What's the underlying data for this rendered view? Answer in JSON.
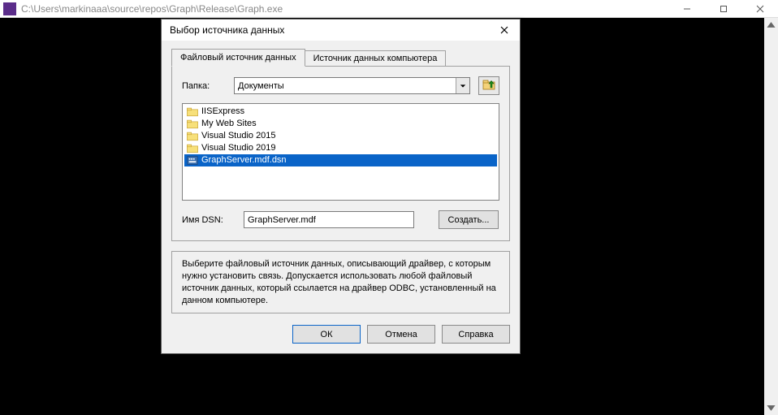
{
  "app": {
    "title": "C:\\Users\\markinaaa\\source\\repos\\Graph\\Release\\Graph.exe"
  },
  "dialog": {
    "title": "Выбор источника данных",
    "tabs": {
      "file": "Файловый источник данных",
      "machine": "Источник данных компьютера"
    },
    "folder": {
      "label": "Папка:",
      "value": "Документы"
    },
    "files": {
      "items": [
        {
          "name": "IISExpress",
          "kind": "folder",
          "selected": false
        },
        {
          "name": "My Web Sites",
          "kind": "folder",
          "selected": false
        },
        {
          "name": "Visual Studio 2015",
          "kind": "folder",
          "selected": false
        },
        {
          "name": "Visual Studio 2019",
          "kind": "folder",
          "selected": false
        },
        {
          "name": "GraphServer.mdf.dsn",
          "kind": "dsn",
          "selected": true
        }
      ]
    },
    "dsn": {
      "label": "Имя DSN:",
      "value": "GraphServer.mdf"
    },
    "create_btn": "Создать...",
    "hint": "Выберите файловый источник данных, описывающий драйвер, с которым нужно установить связь.   Допускается использовать любой файловый источник данных, который ссылается на драйвер ODBC, установленный на данном компьютере.",
    "buttons": {
      "ok": "ОК",
      "cancel": "Отмена",
      "help": "Справка"
    }
  }
}
